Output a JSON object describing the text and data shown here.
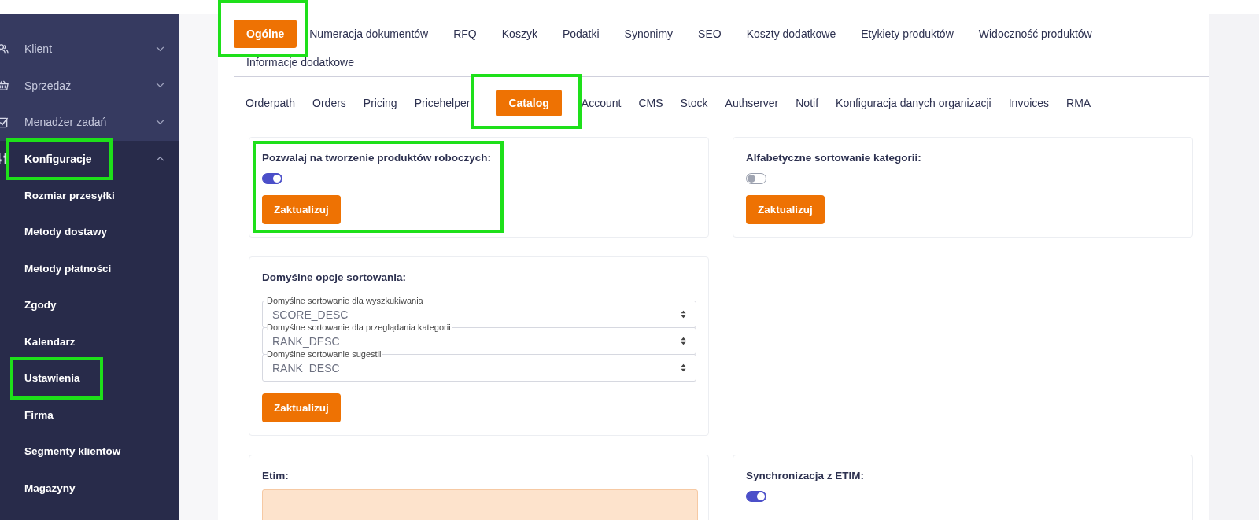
{
  "sidebar": {
    "items": [
      {
        "label": "Klient",
        "expanded": false,
        "highlighted": false
      },
      {
        "label": "Sprzedaż",
        "expanded": false,
        "highlighted": false
      },
      {
        "label": "Menadżer zadań",
        "expanded": false,
        "highlighted": false
      },
      {
        "label": "Konfiguracje",
        "expanded": true,
        "highlighted": true,
        "children": [
          {
            "label": "Rozmiar przesyłki",
            "highlighted": false
          },
          {
            "label": "Metody dostawy",
            "highlighted": false
          },
          {
            "label": "Metody płatności",
            "highlighted": false
          },
          {
            "label": "Zgody",
            "highlighted": false
          },
          {
            "label": "Kalendarz",
            "highlighted": false
          },
          {
            "label": "Ustawienia",
            "highlighted": true
          },
          {
            "label": "Firma",
            "highlighted": false
          },
          {
            "label": "Segmenty klientów",
            "highlighted": false
          },
          {
            "label": "Magazyny",
            "highlighted": false
          }
        ]
      }
    ]
  },
  "tabs": [
    {
      "label": "Ogólne",
      "selected": true,
      "highlighted": true
    },
    {
      "label": "Numeracja dokumentów",
      "selected": false,
      "highlighted": false
    },
    {
      "label": "RFQ",
      "selected": false,
      "highlighted": false
    },
    {
      "label": "Koszyk",
      "selected": false,
      "highlighted": false
    },
    {
      "label": "Podatki",
      "selected": false,
      "highlighted": false
    },
    {
      "label": "Synonimy",
      "selected": false,
      "highlighted": false
    },
    {
      "label": "SEO",
      "selected": false,
      "highlighted": false
    },
    {
      "label": "Koszty dodatkowe",
      "selected": false,
      "highlighted": false
    },
    {
      "label": "Etykiety produktów",
      "selected": false,
      "highlighted": false
    },
    {
      "label": "Widoczność produktów",
      "selected": false,
      "highlighted": false
    },
    {
      "label": "Informacje dodatkowe",
      "selected": false,
      "highlighted": false
    }
  ],
  "subtabs": [
    {
      "label": "Orderpath",
      "selected": false,
      "highlighted": false
    },
    {
      "label": "Orders",
      "selected": false,
      "highlighted": false
    },
    {
      "label": "Pricing",
      "selected": false,
      "highlighted": false
    },
    {
      "label": "Pricehelper",
      "selected": false,
      "highlighted": false
    },
    {
      "label": "Catalog",
      "selected": true,
      "highlighted": true
    },
    {
      "label": "Account",
      "selected": false,
      "highlighted": false
    },
    {
      "label": "CMS",
      "selected": false,
      "highlighted": false
    },
    {
      "label": "Stock",
      "selected": false,
      "highlighted": false
    },
    {
      "label": "Authserver",
      "selected": false,
      "highlighted": false
    },
    {
      "label": "Notif",
      "selected": false,
      "highlighted": false
    },
    {
      "label": "Konfiguracja danych organizacji",
      "selected": false,
      "highlighted": false
    },
    {
      "label": "Invoices",
      "selected": false,
      "highlighted": false
    },
    {
      "label": "RMA",
      "selected": false,
      "highlighted": false
    }
  ],
  "card_rows": [
    [
      {
        "kind": "toggle",
        "title": "Pozwalaj na tworzenie produktów roboczych:",
        "on": true,
        "button": "Zaktualizuj",
        "highlighted": true
      },
      {
        "kind": "toggle",
        "title": "Alfabetyczne sortowanie kategorii:",
        "on": false,
        "button": "Zaktualizuj",
        "highlighted": false
      }
    ],
    [
      {
        "kind": "selects",
        "title": "Domyślne opcje sortowania:",
        "fields": [
          {
            "label": "Domyślne sortowanie dla wyszkukiwania",
            "value": "SCORE_DESC"
          },
          {
            "label": "Domyślne sortowanie dla przeglądania kategorii",
            "value": "RANK_DESC"
          },
          {
            "label": "Domyślne sortowanie sugestii",
            "value": "RANK_DESC"
          }
        ],
        "button": "Zaktualizuj",
        "highlighted": false
      }
    ],
    [
      {
        "kind": "notice",
        "title": "Etim:",
        "highlighted": false
      },
      {
        "kind": "toggle",
        "title": "Synchronizacja z ETIM:",
        "on": true,
        "highlighted": false
      }
    ]
  ]
}
